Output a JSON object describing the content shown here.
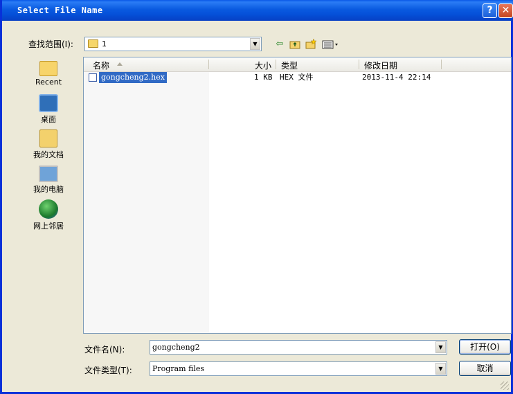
{
  "window": {
    "title": "Select File Name",
    "help_label": "?",
    "close_label": "✕"
  },
  "lookin": {
    "label": "查找范围(I):",
    "value": "1"
  },
  "toolbar": {
    "back_icon": "back-arrow-icon",
    "up_icon": "up-folder-icon",
    "newfolder_icon": "new-folder-icon",
    "views_icon": "views-menu-icon"
  },
  "places": [
    {
      "label": "Recent",
      "icon": "recent-folder-icon"
    },
    {
      "label": "桌面",
      "icon": "desktop-icon"
    },
    {
      "label": "我的文档",
      "icon": "my-documents-icon"
    },
    {
      "label": "我的电脑",
      "icon": "my-computer-icon"
    },
    {
      "label": "网上邻居",
      "icon": "network-places-icon"
    }
  ],
  "columns": {
    "name": "名称",
    "size": "大小",
    "type": "类型",
    "modified": "修改日期"
  },
  "files": [
    {
      "name": "gongcheng2.hex",
      "size": "1 KB",
      "type": "HEX 文件",
      "modified": "2013-11-4 22:14"
    }
  ],
  "filename": {
    "label": "文件名(N):",
    "value": "gongcheng2"
  },
  "filetype": {
    "label": "文件类型(T):",
    "value": "Program files"
  },
  "buttons": {
    "open": "打开(O)",
    "cancel": "取消"
  },
  "colors": {
    "titlebar": "#0a5ae0",
    "selection": "#316ac5",
    "background": "#ece9d8"
  }
}
